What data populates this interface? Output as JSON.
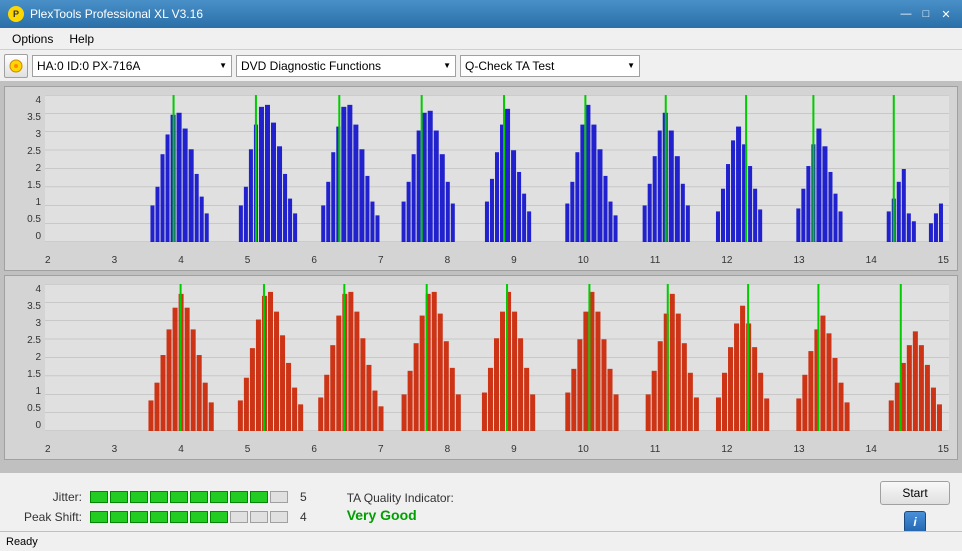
{
  "titleBar": {
    "title": "PlexTools Professional XL V3.16",
    "icon": "P",
    "controls": [
      "—",
      "□",
      "✕"
    ]
  },
  "menuBar": {
    "items": [
      "Options",
      "Help"
    ]
  },
  "toolbar": {
    "driveLabel": "HA:0 ID:0  PX-716A",
    "functionLabel": "DVD Diagnostic Functions",
    "testLabel": "Q-Check TA Test"
  },
  "charts": {
    "top": {
      "color": "blue",
      "yLabels": [
        "4",
        "3.5",
        "3",
        "2.5",
        "2",
        "1.5",
        "1",
        "0.5",
        "0"
      ],
      "xLabels": [
        "2",
        "3",
        "4",
        "5",
        "6",
        "7",
        "8",
        "9",
        "10",
        "11",
        "12",
        "13",
        "14",
        "15"
      ]
    },
    "bottom": {
      "color": "red",
      "yLabels": [
        "4",
        "3.5",
        "3",
        "2.5",
        "2",
        "1.5",
        "1",
        "0.5",
        "0"
      ],
      "xLabels": [
        "2",
        "3",
        "4",
        "5",
        "6",
        "7",
        "8",
        "9",
        "10",
        "11",
        "12",
        "13",
        "14",
        "15"
      ]
    }
  },
  "metrics": {
    "jitter": {
      "label": "Jitter:",
      "filledBlocks": 9,
      "totalBlocks": 10,
      "value": "5"
    },
    "peakShift": {
      "label": "Peak Shift:",
      "filledBlocks": 7,
      "totalBlocks": 10,
      "value": "4"
    },
    "taQuality": {
      "label": "TA Quality Indicator:",
      "value": "Very Good"
    }
  },
  "buttons": {
    "start": "Start",
    "info": "i"
  },
  "statusBar": {
    "text": "Ready"
  }
}
